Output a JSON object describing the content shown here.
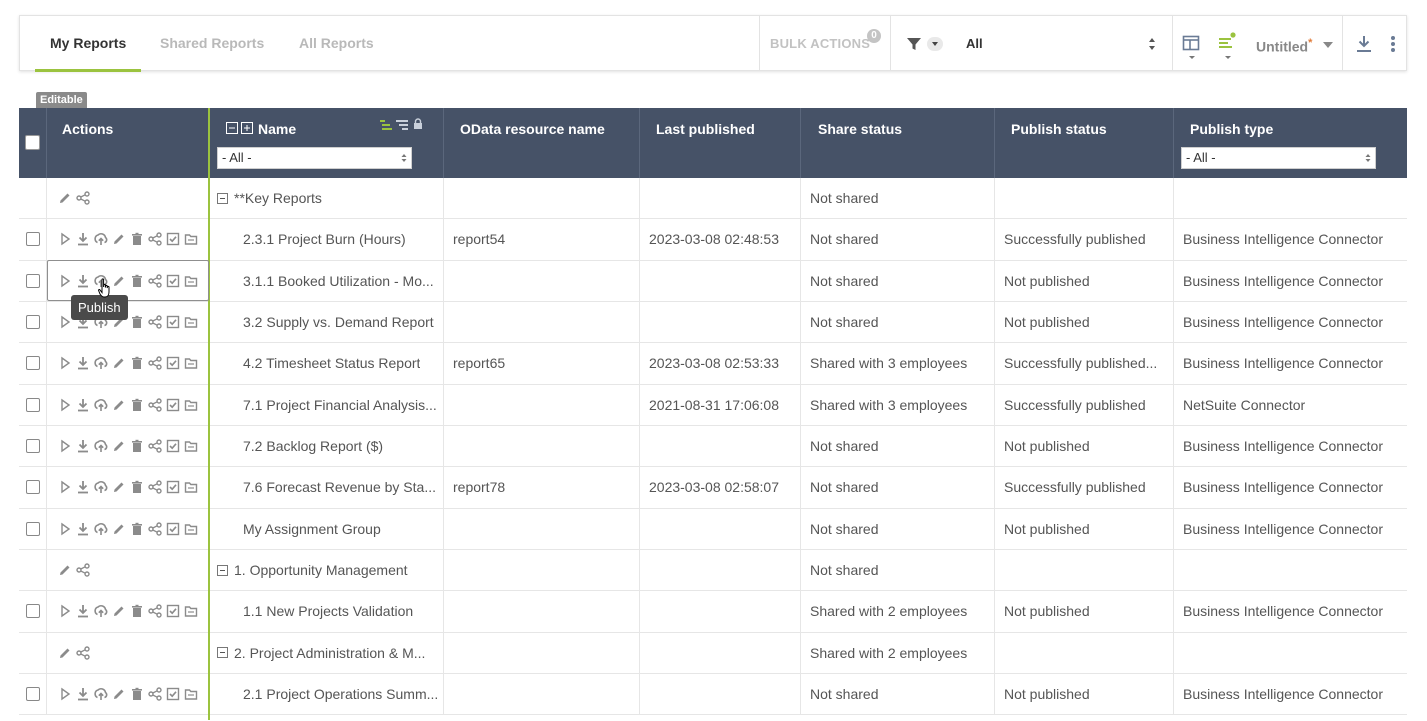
{
  "tabs": [
    {
      "label": "My Reports",
      "active": true
    },
    {
      "label": "Shared Reports",
      "active": false
    },
    {
      "label": "All Reports",
      "active": false
    }
  ],
  "toolbar": {
    "bulk_actions_label": "BULK ACTIONS",
    "bulk_count": "0",
    "filter_value": "All",
    "view_name": "Untitled",
    "view_modified_mark": "*"
  },
  "editable_tag": "Editable",
  "columns": {
    "actions": "Actions",
    "name": "Name",
    "odata": "OData resource name",
    "last_published": "Last published",
    "share_status": "Share status",
    "publish_status": "Publish status",
    "publish_type": "Publish type"
  },
  "filters": {
    "name": "- All -",
    "publish_type": "- All -"
  },
  "tooltip": "Publish",
  "rows": [
    {
      "group": true,
      "name": "**Key Reports",
      "odata": "",
      "last_published": "",
      "share": "Not shared",
      "pstatus": "",
      "ptype": ""
    },
    {
      "group": false,
      "name": "2.3.1 Project Burn (Hours)",
      "odata": "report54",
      "last_published": "2023-03-08 02:48:53",
      "share": "Not shared",
      "pstatus": "Successfully published",
      "ptype": "Business Intelligence Connector"
    },
    {
      "group": false,
      "name": "3.1.1 Booked Utilization - Mo...",
      "odata": "",
      "last_published": "",
      "share": "Not shared",
      "pstatus": "Not published",
      "ptype": "Business Intelligence Connector"
    },
    {
      "group": false,
      "name": "3.2 Supply vs. Demand Report",
      "odata": "",
      "last_published": "",
      "share": "Not shared",
      "pstatus": "Not published",
      "ptype": "Business Intelligence Connector"
    },
    {
      "group": false,
      "name": "4.2 Timesheet Status Report",
      "odata": "report65",
      "last_published": "2023-03-08 02:53:33",
      "share": "Shared with 3 employees",
      "pstatus": "Successfully published...",
      "ptype": "Business Intelligence Connector"
    },
    {
      "group": false,
      "name": "7.1 Project Financial Analysis...",
      "odata": "",
      "last_published": "2021-08-31 17:06:08",
      "share": "Shared with 3 employees",
      "pstatus": "Successfully published",
      "ptype": "NetSuite Connector"
    },
    {
      "group": false,
      "name": "7.2 Backlog Report ($)",
      "odata": "",
      "last_published": "",
      "share": "Not shared",
      "pstatus": "Not published",
      "ptype": "Business Intelligence Connector"
    },
    {
      "group": false,
      "name": "7.6 Forecast Revenue by Sta...",
      "odata": "report78",
      "last_published": "2023-03-08 02:58:07",
      "share": "Not shared",
      "pstatus": "Successfully published",
      "ptype": "Business Intelligence Connector"
    },
    {
      "group": false,
      "name": "My Assignment Group",
      "odata": "",
      "last_published": "",
      "share": "Not shared",
      "pstatus": "Not published",
      "ptype": "Business Intelligence Connector"
    },
    {
      "group": true,
      "name": "1. Opportunity Management",
      "odata": "",
      "last_published": "",
      "share": "Not shared",
      "pstatus": "",
      "ptype": ""
    },
    {
      "group": false,
      "name": "1.1 New Projects Validation",
      "odata": "",
      "last_published": "",
      "share": "Shared with 2 employees",
      "pstatus": "Not published",
      "ptype": "Business Intelligence Connector"
    },
    {
      "group": true,
      "name": "2. Project Administration & M...",
      "odata": "",
      "last_published": "",
      "share": "Shared with 2 employees",
      "pstatus": "",
      "ptype": ""
    },
    {
      "group": false,
      "name": "2.1 Project Operations Summ...",
      "odata": "",
      "last_published": "",
      "share": "Not shared",
      "pstatus": "Not published",
      "ptype": "Business Intelligence Connector"
    }
  ],
  "icons": {
    "run": "play-icon",
    "download": "download-icon",
    "publish": "publish-icon",
    "edit": "pencil-icon",
    "delete": "trash-icon",
    "share": "share-icon",
    "approve": "checkbox-icon",
    "folder": "folder-icon"
  },
  "colors": {
    "accent": "#9bc33f",
    "header_bg": "#465267"
  }
}
